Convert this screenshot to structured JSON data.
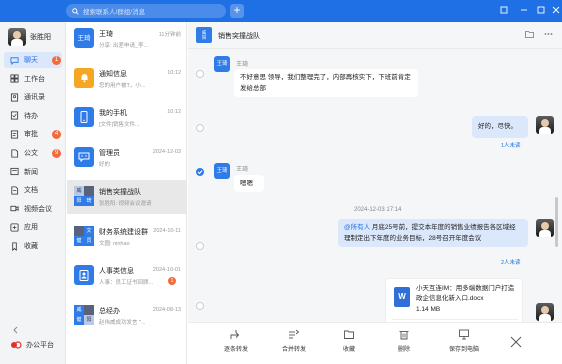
{
  "search": {
    "placeholder": "搜索联系人/群组/消息"
  },
  "colors": {
    "brand": "#1f6fe5",
    "badge": "#f26b3a",
    "selected_bubble": "#dbe8fb"
  },
  "user": {
    "name": "张胜阳"
  },
  "nav": [
    {
      "label": "聊天",
      "icon": "chat-icon",
      "badge": "1"
    },
    {
      "label": "工作台",
      "icon": "workbench-icon",
      "badge": ""
    },
    {
      "label": "通讯录",
      "icon": "contacts-icon",
      "badge": ""
    },
    {
      "label": "待办",
      "icon": "todo-icon",
      "badge": ""
    },
    {
      "label": "审批",
      "icon": "approval-icon",
      "badge": "4"
    },
    {
      "label": "公文",
      "icon": "document-icon",
      "badge": "9"
    },
    {
      "label": "新闻",
      "icon": "news-icon",
      "badge": ""
    },
    {
      "label": "文档",
      "icon": "docs-icon",
      "badge": ""
    },
    {
      "label": "视频会议",
      "icon": "video-meeting-icon",
      "badge": ""
    },
    {
      "label": "应用",
      "icon": "apps-icon",
      "badge": ""
    },
    {
      "label": "收藏",
      "icon": "favorites-icon",
      "badge": ""
    }
  ],
  "platform": {
    "label": "办公平台"
  },
  "conversations": [
    {
      "name": "王琦",
      "time": "11分钟前",
      "preview": "分享: 出差申请_李...",
      "avatar": "王琦",
      "color": "#2f7be8",
      "badge": ""
    },
    {
      "name": "通知信息",
      "time": "10:12",
      "preview": "您的用户被T，小...",
      "avatar": "bell",
      "color": "#f5a623",
      "badge": ""
    },
    {
      "name": "我的手机",
      "time": "10:12",
      "preview": "[文件]销售文件...",
      "avatar": "phone",
      "color": "#2f7be8",
      "badge": ""
    },
    {
      "name": "管理员",
      "time": "2024-12-03",
      "preview": "好的",
      "avatar": "admin",
      "color": "#2f7be8",
      "badge": ""
    },
    {
      "name": "销售突撞战队",
      "time": "",
      "preview": "张胜阳: 视频会议邀请",
      "avatar": "group",
      "color": "#2f7be8",
      "badge": ""
    },
    {
      "name": "财务系统建设群",
      "time": "2024-10-11",
      "preview": "文圆: ninhao",
      "avatar": "group2",
      "color": "#2f7be8",
      "badge": ""
    },
    {
      "name": "人事类信息",
      "time": "2024-10-01",
      "preview": "人事：员工证书回顾...",
      "avatar": "hr",
      "color": "#2f7be8",
      "badge": "1"
    },
    {
      "name": "总经办",
      "time": "2024-08-13",
      "preview": "赵伟威成功发言 \"...",
      "avatar": "group3",
      "color": "#2f7be8",
      "badge": ""
    }
  ],
  "chat": {
    "title": "销售突撞战队",
    "messages": [
      {
        "sender": "王琦",
        "text": "不好意思 领导，我们整理完了，内部再核实下，下班前肯定发给总部"
      },
      {
        "text": "好的，尽快。",
        "read": "1人未读"
      },
      {
        "sender": "王琦",
        "text": "嗯嗯"
      },
      {
        "timestamp": "2024-12-03 17:14"
      },
      {
        "mention": "@所有人",
        "text": " 月底25号前，提交本年度的销售业绩报告各区域经理制定出下年度的业务目标，28号召开年度会议",
        "read": "2人未读"
      },
      {
        "file_name": "小天互连IM：用多端数据门户打造政企信息化新入口.docx",
        "file_size": "1.14 MB"
      }
    ]
  },
  "actions": [
    {
      "label": "逐条转发",
      "icon": "forward-icon"
    },
    {
      "label": "合并转发",
      "icon": "merge-forward-icon"
    },
    {
      "label": "收藏",
      "icon": "favorite-icon"
    },
    {
      "label": "删除",
      "icon": "delete-icon"
    },
    {
      "label": "保存到电脑",
      "icon": "save-to-pc-icon"
    }
  ]
}
